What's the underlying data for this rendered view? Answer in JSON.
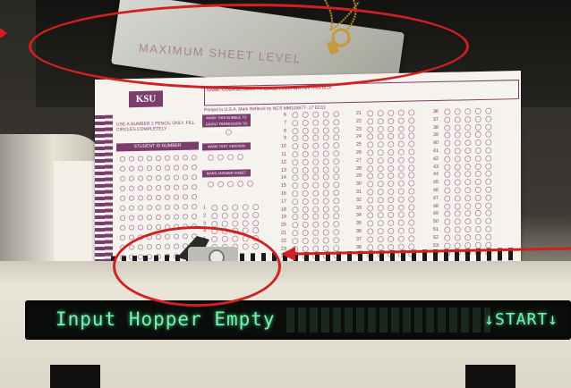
{
  "level_plate": {
    "text": "MAXIMUM SHEET LEVEL"
  },
  "sheet": {
    "logo": "KSU",
    "name_prompt": "NAME, COURSE, DATE – PLEASE PRINT WITHIN THIS BOX",
    "printed_line": "Printed in U.S.A.        Mark Reflex® by NCS MM103677- 17      ED11",
    "pencil_note": "USE A NUMBER 2 PENCIL ONLY. FILL CIRCLES COMPLETELY",
    "student_id_header": "STUDENT ID NUMBER",
    "grant_header": "MARK THIS BUBBLE TO GRANT PERMISSION TO POST YOUR SCORE",
    "test_version_header": "MARK TEST VERSION NUMBER",
    "answer_sheet_header": "MARK ANSWER SHEET NUMBER"
  },
  "display": {
    "message": "Input Hopper Empty",
    "start": "↓START↓"
  },
  "colors": {
    "annotation_red": "#d02020",
    "form_purple": "#7a3d6d",
    "vfd_green": "#7cf0b0"
  }
}
